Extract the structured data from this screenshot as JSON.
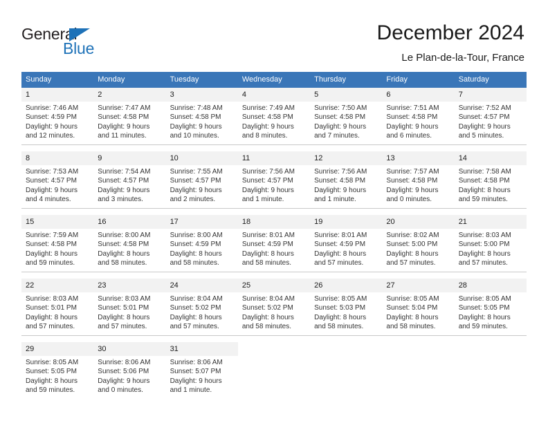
{
  "brand": {
    "name_part1": "General",
    "name_part2": "Blue",
    "color_dark": "#231f20",
    "color_blue": "#1e72b8"
  },
  "header": {
    "title": "December 2024",
    "subtitle": "Le Plan-de-la-Tour, France",
    "header_bg": "#3a76b8",
    "daynum_bg": "#f2f2f2"
  },
  "weekdays": [
    "Sunday",
    "Monday",
    "Tuesday",
    "Wednesday",
    "Thursday",
    "Friday",
    "Saturday"
  ],
  "weeks": [
    [
      {
        "day": "1",
        "sunrise": "Sunrise: 7:46 AM",
        "sunset": "Sunset: 4:59 PM",
        "daylight1": "Daylight: 9 hours",
        "daylight2": "and 12 minutes."
      },
      {
        "day": "2",
        "sunrise": "Sunrise: 7:47 AM",
        "sunset": "Sunset: 4:58 PM",
        "daylight1": "Daylight: 9 hours",
        "daylight2": "and 11 minutes."
      },
      {
        "day": "3",
        "sunrise": "Sunrise: 7:48 AM",
        "sunset": "Sunset: 4:58 PM",
        "daylight1": "Daylight: 9 hours",
        "daylight2": "and 10 minutes."
      },
      {
        "day": "4",
        "sunrise": "Sunrise: 7:49 AM",
        "sunset": "Sunset: 4:58 PM",
        "daylight1": "Daylight: 9 hours",
        "daylight2": "and 8 minutes."
      },
      {
        "day": "5",
        "sunrise": "Sunrise: 7:50 AM",
        "sunset": "Sunset: 4:58 PM",
        "daylight1": "Daylight: 9 hours",
        "daylight2": "and 7 minutes."
      },
      {
        "day": "6",
        "sunrise": "Sunrise: 7:51 AM",
        "sunset": "Sunset: 4:58 PM",
        "daylight1": "Daylight: 9 hours",
        "daylight2": "and 6 minutes."
      },
      {
        "day": "7",
        "sunrise": "Sunrise: 7:52 AM",
        "sunset": "Sunset: 4:57 PM",
        "daylight1": "Daylight: 9 hours",
        "daylight2": "and 5 minutes."
      }
    ],
    [
      {
        "day": "8",
        "sunrise": "Sunrise: 7:53 AM",
        "sunset": "Sunset: 4:57 PM",
        "daylight1": "Daylight: 9 hours",
        "daylight2": "and 4 minutes."
      },
      {
        "day": "9",
        "sunrise": "Sunrise: 7:54 AM",
        "sunset": "Sunset: 4:57 PM",
        "daylight1": "Daylight: 9 hours",
        "daylight2": "and 3 minutes."
      },
      {
        "day": "10",
        "sunrise": "Sunrise: 7:55 AM",
        "sunset": "Sunset: 4:57 PM",
        "daylight1": "Daylight: 9 hours",
        "daylight2": "and 2 minutes."
      },
      {
        "day": "11",
        "sunrise": "Sunrise: 7:56 AM",
        "sunset": "Sunset: 4:57 PM",
        "daylight1": "Daylight: 9 hours",
        "daylight2": "and 1 minute."
      },
      {
        "day": "12",
        "sunrise": "Sunrise: 7:56 AM",
        "sunset": "Sunset: 4:58 PM",
        "daylight1": "Daylight: 9 hours",
        "daylight2": "and 1 minute."
      },
      {
        "day": "13",
        "sunrise": "Sunrise: 7:57 AM",
        "sunset": "Sunset: 4:58 PM",
        "daylight1": "Daylight: 9 hours",
        "daylight2": "and 0 minutes."
      },
      {
        "day": "14",
        "sunrise": "Sunrise: 7:58 AM",
        "sunset": "Sunset: 4:58 PM",
        "daylight1": "Daylight: 8 hours",
        "daylight2": "and 59 minutes."
      }
    ],
    [
      {
        "day": "15",
        "sunrise": "Sunrise: 7:59 AM",
        "sunset": "Sunset: 4:58 PM",
        "daylight1": "Daylight: 8 hours",
        "daylight2": "and 59 minutes."
      },
      {
        "day": "16",
        "sunrise": "Sunrise: 8:00 AM",
        "sunset": "Sunset: 4:58 PM",
        "daylight1": "Daylight: 8 hours",
        "daylight2": "and 58 minutes."
      },
      {
        "day": "17",
        "sunrise": "Sunrise: 8:00 AM",
        "sunset": "Sunset: 4:59 PM",
        "daylight1": "Daylight: 8 hours",
        "daylight2": "and 58 minutes."
      },
      {
        "day": "18",
        "sunrise": "Sunrise: 8:01 AM",
        "sunset": "Sunset: 4:59 PM",
        "daylight1": "Daylight: 8 hours",
        "daylight2": "and 58 minutes."
      },
      {
        "day": "19",
        "sunrise": "Sunrise: 8:01 AM",
        "sunset": "Sunset: 4:59 PM",
        "daylight1": "Daylight: 8 hours",
        "daylight2": "and 57 minutes."
      },
      {
        "day": "20",
        "sunrise": "Sunrise: 8:02 AM",
        "sunset": "Sunset: 5:00 PM",
        "daylight1": "Daylight: 8 hours",
        "daylight2": "and 57 minutes."
      },
      {
        "day": "21",
        "sunrise": "Sunrise: 8:03 AM",
        "sunset": "Sunset: 5:00 PM",
        "daylight1": "Daylight: 8 hours",
        "daylight2": "and 57 minutes."
      }
    ],
    [
      {
        "day": "22",
        "sunrise": "Sunrise: 8:03 AM",
        "sunset": "Sunset: 5:01 PM",
        "daylight1": "Daylight: 8 hours",
        "daylight2": "and 57 minutes."
      },
      {
        "day": "23",
        "sunrise": "Sunrise: 8:03 AM",
        "sunset": "Sunset: 5:01 PM",
        "daylight1": "Daylight: 8 hours",
        "daylight2": "and 57 minutes."
      },
      {
        "day": "24",
        "sunrise": "Sunrise: 8:04 AM",
        "sunset": "Sunset: 5:02 PM",
        "daylight1": "Daylight: 8 hours",
        "daylight2": "and 57 minutes."
      },
      {
        "day": "25",
        "sunrise": "Sunrise: 8:04 AM",
        "sunset": "Sunset: 5:02 PM",
        "daylight1": "Daylight: 8 hours",
        "daylight2": "and 58 minutes."
      },
      {
        "day": "26",
        "sunrise": "Sunrise: 8:05 AM",
        "sunset": "Sunset: 5:03 PM",
        "daylight1": "Daylight: 8 hours",
        "daylight2": "and 58 minutes."
      },
      {
        "day": "27",
        "sunrise": "Sunrise: 8:05 AM",
        "sunset": "Sunset: 5:04 PM",
        "daylight1": "Daylight: 8 hours",
        "daylight2": "and 58 minutes."
      },
      {
        "day": "28",
        "sunrise": "Sunrise: 8:05 AM",
        "sunset": "Sunset: 5:05 PM",
        "daylight1": "Daylight: 8 hours",
        "daylight2": "and 59 minutes."
      }
    ],
    [
      {
        "day": "29",
        "sunrise": "Sunrise: 8:05 AM",
        "sunset": "Sunset: 5:05 PM",
        "daylight1": "Daylight: 8 hours",
        "daylight2": "and 59 minutes."
      },
      {
        "day": "30",
        "sunrise": "Sunrise: 8:06 AM",
        "sunset": "Sunset: 5:06 PM",
        "daylight1": "Daylight: 9 hours",
        "daylight2": "and 0 minutes."
      },
      {
        "day": "31",
        "sunrise": "Sunrise: 8:06 AM",
        "sunset": "Sunset: 5:07 PM",
        "daylight1": "Daylight: 9 hours",
        "daylight2": "and 1 minute."
      },
      {
        "day": "",
        "sunrise": "",
        "sunset": "",
        "daylight1": "",
        "daylight2": ""
      },
      {
        "day": "",
        "sunrise": "",
        "sunset": "",
        "daylight1": "",
        "daylight2": ""
      },
      {
        "day": "",
        "sunrise": "",
        "sunset": "",
        "daylight1": "",
        "daylight2": ""
      },
      {
        "day": "",
        "sunrise": "",
        "sunset": "",
        "daylight1": "",
        "daylight2": ""
      }
    ]
  ]
}
